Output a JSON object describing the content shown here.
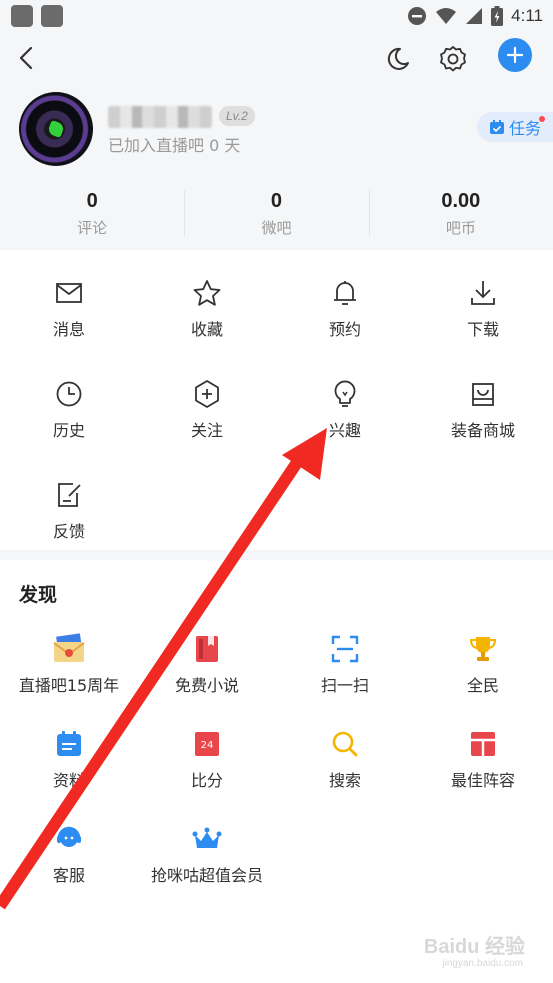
{
  "status_bar": {
    "time": "4:11",
    "icons": [
      "minus-circle-icon",
      "wifi-icon",
      "signal-icon",
      "battery-icon"
    ]
  },
  "topbar": {
    "back_icon": "back-arrow-icon",
    "night_icon": "moon-icon",
    "settings_icon": "gear-icon",
    "add_icon": "plus-icon"
  },
  "profile": {
    "level": "Lv.2",
    "joined_text": "已加入直播吧 0 天",
    "task_label": "任务"
  },
  "stats": [
    {
      "value": "0",
      "label": "评论"
    },
    {
      "value": "0",
      "label": "微吧"
    },
    {
      "value": "0.00",
      "label": "吧币"
    }
  ],
  "menu": [
    {
      "label": "消息",
      "icon": "mail-icon"
    },
    {
      "label": "收藏",
      "icon": "star-icon"
    },
    {
      "label": "预约",
      "icon": "bell-icon"
    },
    {
      "label": "下载",
      "icon": "download-icon"
    },
    {
      "label": "历史",
      "icon": "clock-icon"
    },
    {
      "label": "关注",
      "icon": "plus-hexagon-icon"
    },
    {
      "label": "兴趣",
      "icon": "lightbulb-icon"
    },
    {
      "label": "装备商城",
      "icon": "shopping-bag-icon"
    },
    {
      "label": "反馈",
      "icon": "feedback-edit-icon"
    }
  ],
  "discover": {
    "title": "发现",
    "items": [
      {
        "label": "直播吧15周年",
        "icon": "envelope-anniversary-icon"
      },
      {
        "label": "免费小说",
        "icon": "book-icon"
      },
      {
        "label": "扫一扫",
        "icon": "scan-icon"
      },
      {
        "label": "全民",
        "icon": "trophy-icon"
      },
      {
        "label": "资料",
        "icon": "calendar-icon"
      },
      {
        "label": "比分",
        "icon": "scoreboard-icon"
      },
      {
        "label": "搜索",
        "icon": "search-icon"
      },
      {
        "label": "最佳阵容",
        "icon": "lineup-icon"
      },
      {
        "label": "客服",
        "icon": "customer-service-icon"
      },
      {
        "label": "抢咪咕超值会员",
        "icon": "crown-icon"
      }
    ]
  },
  "colors": {
    "accent": "#2d8cf0",
    "arrow": "#f02a22",
    "header_bg": "#f5f6f8"
  },
  "watermark": {
    "text": "Baidu 经验",
    "subtext": "jingyan.baidu.com"
  }
}
